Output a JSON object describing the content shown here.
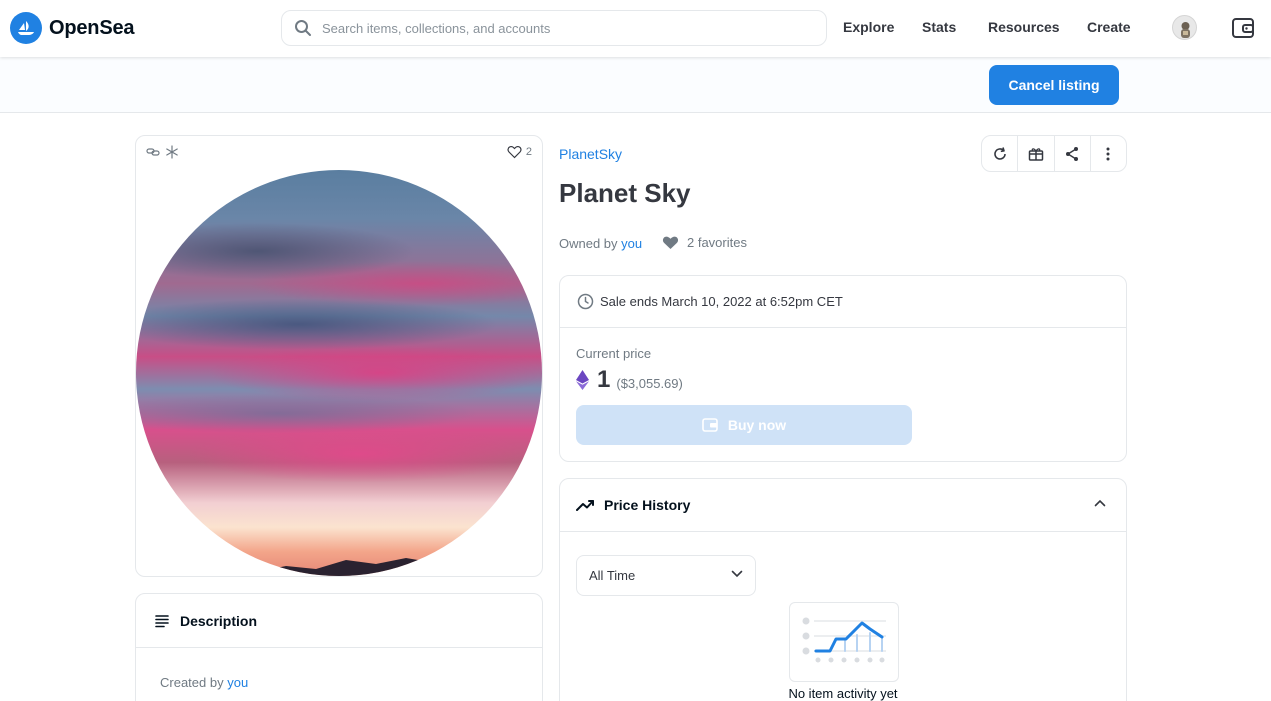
{
  "header": {
    "brand": "OpenSea",
    "search_placeholder": "Search items, collections, and accounts",
    "nav": [
      "Explore",
      "Stats",
      "Resources",
      "Create"
    ]
  },
  "subbar": {
    "cancel_listing_label": "Cancel listing"
  },
  "item": {
    "collection": "PlanetSky",
    "title": "Planet Sky",
    "owned_by_prefix": "Owned by",
    "owner": "you",
    "favorites_count_mini": "2",
    "favorites_label": "2 favorites"
  },
  "sale": {
    "ends_text": "Sale ends March 10, 2022 at 6:52pm CET",
    "current_price_label": "Current price",
    "price_eth": "1",
    "price_usd": "($3,055.69)",
    "buy_label": "Buy now"
  },
  "price_history": {
    "title": "Price History",
    "range": "All Time",
    "empty_text": "No item activity yet"
  },
  "description": {
    "title": "Description",
    "created_prefix": "Created by",
    "creator": "you"
  },
  "colors": {
    "accent": "#2081e2",
    "buy_disabled": "#cfe2f7",
    "border": "#e5e8eb",
    "eth": "#6b46c1"
  }
}
